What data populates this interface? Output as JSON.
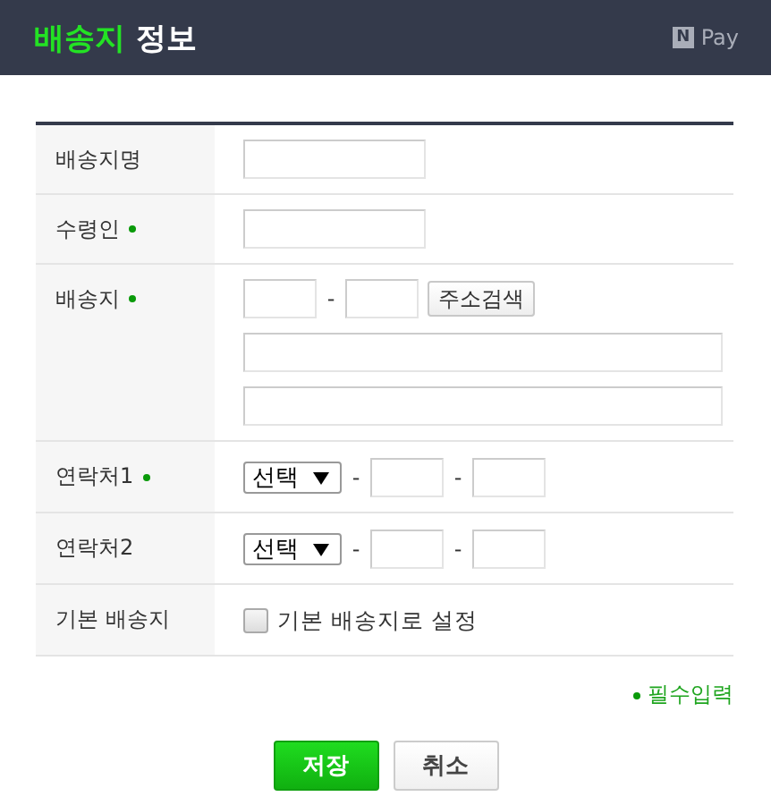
{
  "header": {
    "title_highlight": "배송지",
    "title_rest": "정보",
    "badge": "N",
    "brand": "Pay"
  },
  "rows": [
    {
      "kind": "text",
      "label": "배송지명",
      "required": false
    },
    {
      "kind": "text",
      "label": "수령인",
      "required": true
    },
    {
      "kind": "address",
      "label": "배송지",
      "required": true,
      "separator": "-",
      "search_button": "주소검색"
    },
    {
      "kind": "phone",
      "label": "연락처1",
      "required": true,
      "select": "선택",
      "separator": "-"
    },
    {
      "kind": "phone",
      "label": "연락처2",
      "required": false,
      "select": "선택",
      "separator": "-"
    },
    {
      "kind": "checkbox",
      "label": "기본 배송지",
      "required": false,
      "checked": false,
      "option": "기본 배송지로 설정"
    }
  ],
  "legend": "필수입력",
  "buttons": [
    {
      "label": "저장",
      "primary": true
    },
    {
      "label": "취소",
      "primary": false
    }
  ]
}
